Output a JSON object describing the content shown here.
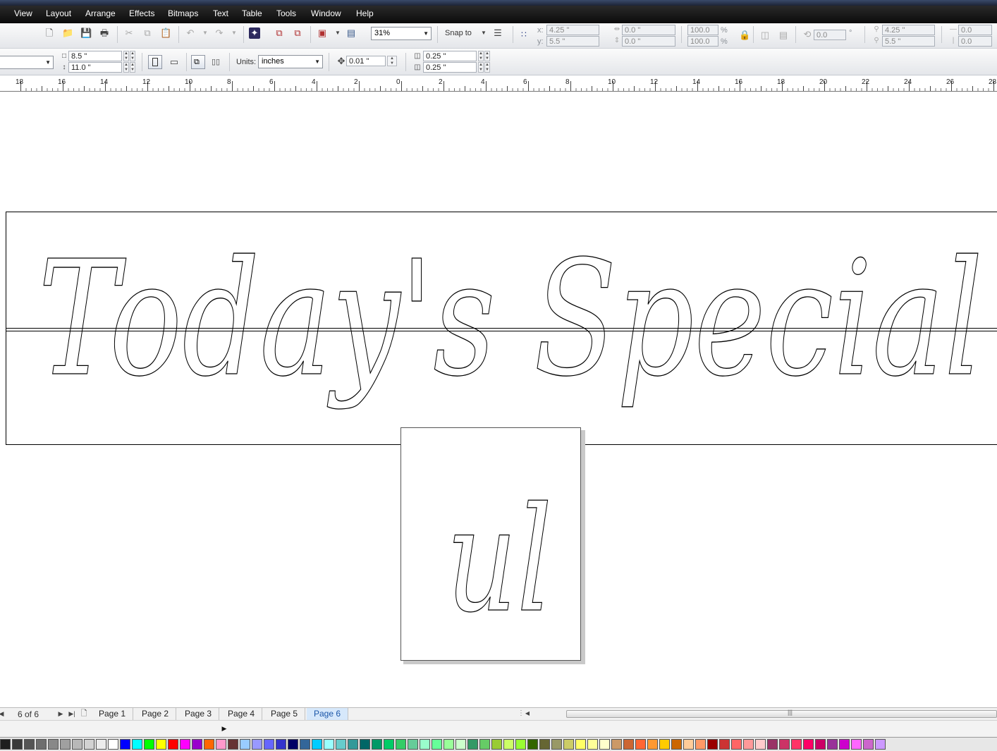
{
  "menu": [
    "View",
    "Layout",
    "Arrange",
    "Effects",
    "Bitmaps",
    "Text",
    "Table",
    "Tools",
    "Window",
    "Help"
  ],
  "toolbar": {
    "zoom": "31%",
    "snap_to": "Snap to",
    "x_label": "x:",
    "x": "4.25 \"",
    "y_label": "y:",
    "y": "5.5 \"",
    "w": "0.0 \"",
    "h": "0.0 \"",
    "scale_x": "100.0",
    "scale_y": "100.0",
    "pct": "%",
    "rotation": "0.0",
    "deg": "°",
    "cx": "4.25 \"",
    "cy": "5.5 \"",
    "skew_a": "0.0",
    "skew_b": "0.0"
  },
  "property_bar": {
    "paper_size": "",
    "page_width": "8.5 \"",
    "page_height": "11.0 \"",
    "units_label": "Units:",
    "units": "inches",
    "nudge": "0.01 \"",
    "dup_x": "0.25 \"",
    "dup_y": "0.25 \""
  },
  "ruler": {
    "ticks": [
      "18",
      "16",
      "14",
      "12",
      "10",
      "8",
      "6",
      "4",
      "2",
      "0",
      "2",
      "4",
      "6",
      "8",
      "10",
      "12",
      "14",
      "16",
      "18",
      "20",
      "22",
      "24",
      "26",
      "28"
    ]
  },
  "canvas": {
    "banner_text": "Today's Special",
    "page_text": "ul"
  },
  "pages": {
    "counter": "6 of 6",
    "tabs": [
      "Page 1",
      "Page 2",
      "Page 3",
      "Page 4",
      "Page 5",
      "Page 6"
    ],
    "active_index": 5
  },
  "palette": [
    "#1e1e1e",
    "#3a3a3a",
    "#555555",
    "#6e6e6e",
    "#888888",
    "#a0a0a0",
    "#b8b8b8",
    "#d2d2d2",
    "#ececec",
    "#ffffff",
    "#0000ff",
    "#00ffff",
    "#00ff00",
    "#ffff00",
    "#ff0000",
    "#ff00ff",
    "#9900cc",
    "#ff6600",
    "#ff99cc",
    "#663333",
    "#99ccff",
    "#9999ff",
    "#6666ff",
    "#3333cc",
    "#000066",
    "#336699",
    "#00ccff",
    "#99ffff",
    "#66cccc",
    "#339999",
    "#006666",
    "#009966",
    "#00cc66",
    "#33cc66",
    "#66cc99",
    "#99ffcc",
    "#66ff99",
    "#99ff99",
    "#ccffcc",
    "#339966",
    "#66cc66",
    "#99cc33",
    "#ccff66",
    "#99ff33",
    "#336600",
    "#666633",
    "#999966",
    "#cccc66",
    "#ffff66",
    "#ffff99",
    "#ffffcc",
    "#cc9966",
    "#cc6633",
    "#ff6633",
    "#ff9933",
    "#ffcc00",
    "#cc6600",
    "#ffcc99",
    "#ff9966",
    "#990000",
    "#cc3333",
    "#ff6666",
    "#ff9999",
    "#ffcccc",
    "#993366",
    "#cc3366",
    "#ff3366",
    "#ff0066",
    "#cc0066",
    "#993399",
    "#cc00cc",
    "#ff66ff",
    "#cc66cc",
    "#cc99ff"
  ]
}
